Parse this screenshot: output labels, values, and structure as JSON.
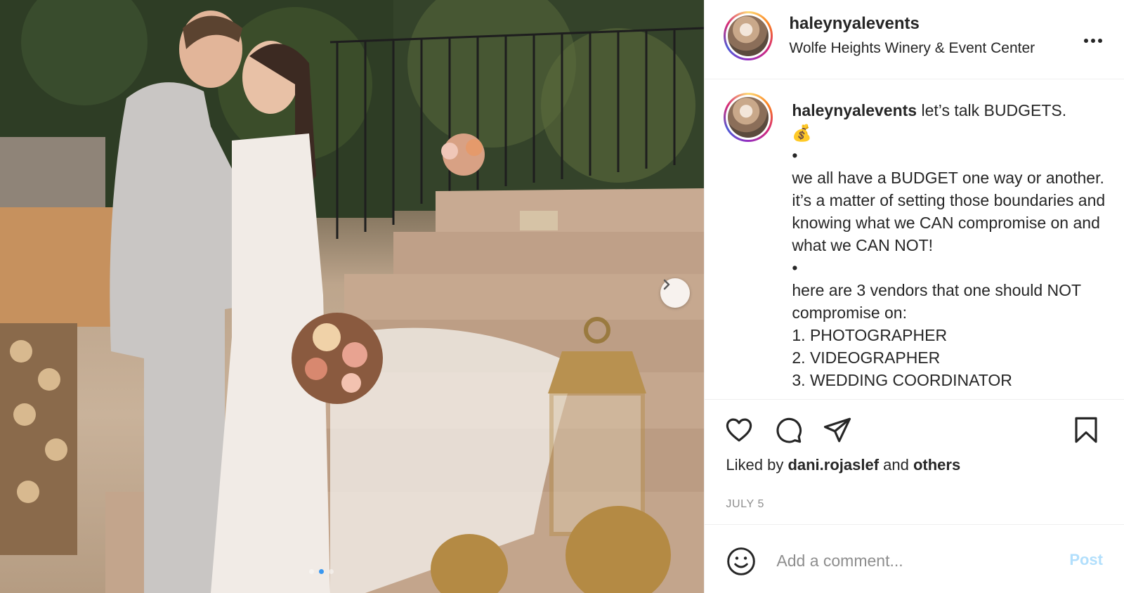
{
  "post": {
    "username": "haleynyalevents",
    "location": "Wolfe Heights Winery & Event Center",
    "more_label": "•••",
    "carousel": {
      "dot_count": 3,
      "active_dot": 2
    },
    "caption": {
      "username": "haleynyalevents",
      "lines": [
        " let’s talk BUDGETS.",
        "💰",
        "•",
        "we all have a BUDGET one way or another. it’s a matter of setting those boundaries and knowing what we CAN compromise on and what we CAN NOT!",
        "•",
        "here are 3 vendors that one should NOT compromise on:",
        "1. PHOTOGRAPHER",
        "2. VIDEOGRAPHER",
        "3. WEDDING COORDINATOR"
      ]
    },
    "likes": {
      "prefix": "Liked by ",
      "user": "dani.rojaslef",
      "middle": " and ",
      "others": "others"
    },
    "date": "JULY 5",
    "comment": {
      "placeholder": "Add a comment...",
      "post_label": "Post"
    },
    "colors": {
      "link_blue_disabled": "#b2dffc",
      "meta_gray": "#8e8e8e",
      "text": "#262626"
    }
  }
}
